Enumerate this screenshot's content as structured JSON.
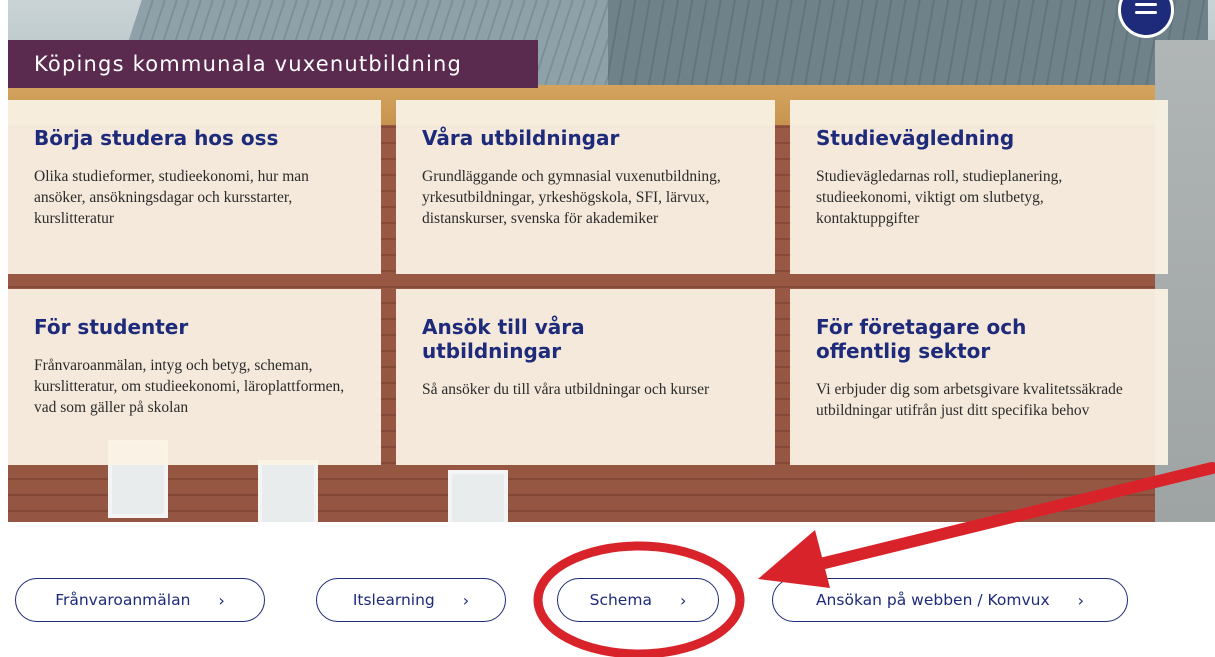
{
  "header": {
    "site_title": "Köpings kommunala vuxenutbildning",
    "menu_icon": "hamburger-menu-icon"
  },
  "cards": [
    {
      "title": "Börja studera hos oss",
      "text": "Olika studieformer, studieekonomi, hur man ansöker, ansökningsdagar och kursstarter, kurslitteratur"
    },
    {
      "title": "Våra utbildningar",
      "text": "Grundläggande och gymnasial vuxenutbildning, yrkesutbildningar, yrkeshögskola, SFI, lärvux, distanskurser, svenska för akademiker"
    },
    {
      "title": "Studievägledning",
      "text": "Studievägledarnas roll, studieplanering, studieekonomi, viktigt om slutbetyg, kontaktuppgifter"
    },
    {
      "title": "För studenter",
      "text": "Frånvaroanmälan, intyg och betyg, scheman, kurslitteratur, om studieekonomi, läroplattformen, vad som gäller på skolan"
    },
    {
      "title": "Ansök till våra utbildningar",
      "text": "Så ansöker du till våra utbildningar och kurser"
    },
    {
      "title": "För företagare och offentlig sektor",
      "text": "Vi erbjuder dig som arbetsgivare kvalitetssäkrade utbildningar utifrån just ditt specifika behov"
    }
  ],
  "quick_links": [
    {
      "label": "Frånvaroanmälan",
      "chevron": "›"
    },
    {
      "label": "Itslearning",
      "chevron": "›"
    },
    {
      "label": "Schema",
      "chevron": "›"
    },
    {
      "label": "Ansökan på webben / Komvux",
      "chevron": "›"
    }
  ],
  "colors": {
    "brand_navy": "#1e2a7a",
    "title_bg": "#5a2a4f",
    "card_bg": "#faf2e4",
    "annotation_red": "#d9232a"
  }
}
